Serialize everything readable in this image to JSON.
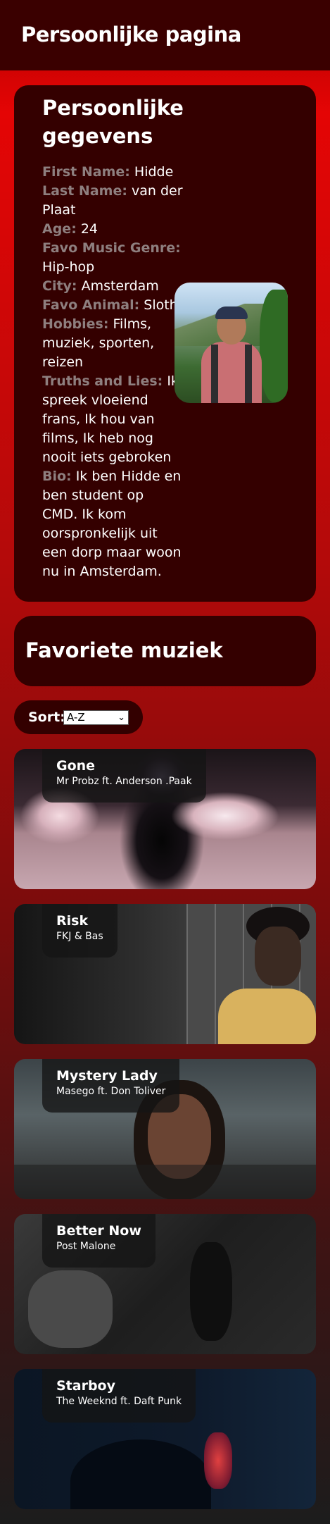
{
  "header": {
    "title": "Persoonlijke pagina"
  },
  "personal": {
    "heading": "Persoonlijke gegevens",
    "fields": [
      {
        "label": "First Name:",
        "value": "Hidde"
      },
      {
        "label": "Last Name:",
        "value": "van der Plaat"
      },
      {
        "label": "Age:",
        "value": "24"
      },
      {
        "label": "Favo Music Genre:",
        "value": "Hip-hop"
      },
      {
        "label": "City:",
        "value": "Amsterdam"
      },
      {
        "label": "Favo Animal:",
        "value": "Sloth"
      },
      {
        "label": "Hobbies:",
        "value": "Films, muziek, sporten, reizen"
      },
      {
        "label": "Truths and Lies:",
        "value": "Ik spreek vloeiend frans, Ik hou van films, Ik heb nog nooit iets gebroken"
      },
      {
        "label": "Bio:",
        "value": "Ik ben Hidde en ben student op CMD. Ik kom oorspronkelijk uit een dorp maar woon nu in Amsterdam."
      }
    ]
  },
  "music": {
    "heading": "Favoriete muziek",
    "sort_label": "Sort:",
    "sort_selected": "A-Z",
    "songs": [
      {
        "title": "Gone",
        "artist": "Mr Probz ft. Anderson .Paak"
      },
      {
        "title": "Risk",
        "artist": "FKJ & Bas"
      },
      {
        "title": "Mystery Lady",
        "artist": "Masego ft. Don Toliver"
      },
      {
        "title": "Better Now",
        "artist": "Post Malone"
      },
      {
        "title": "Starboy",
        "artist": "The Weeknd ft. Daft Punk"
      }
    ]
  },
  "colors": {
    "header_bg": "#3a0000",
    "card_bg": "#340000",
    "label_gray": "#8e7f7f"
  }
}
